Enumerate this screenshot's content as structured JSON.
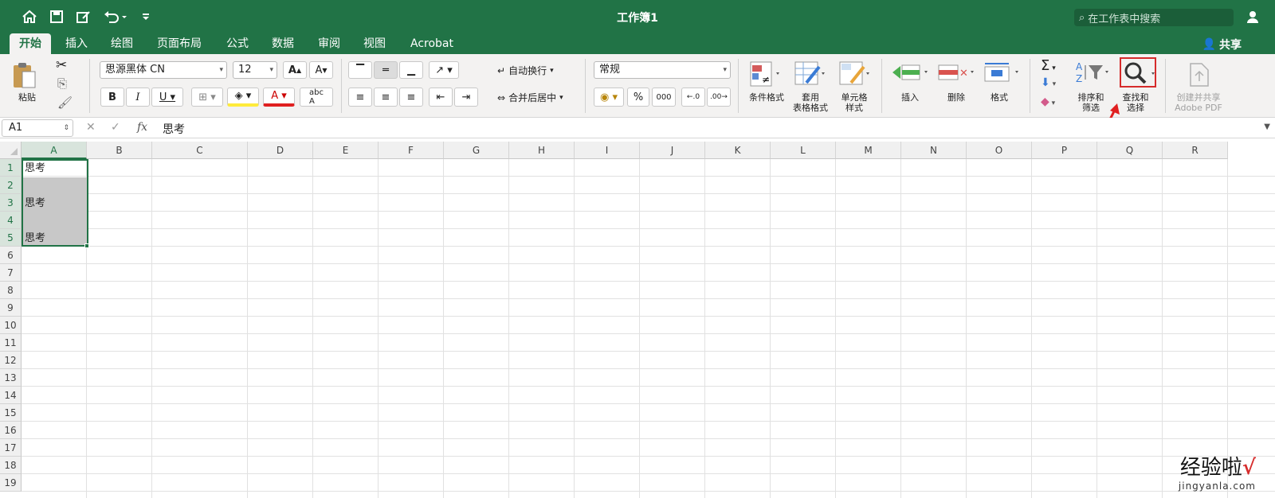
{
  "title_bar": {
    "title": "工作簿1",
    "search_placeholder": "在工作表中搜索"
  },
  "tabs": [
    {
      "label": "开始",
      "active": true
    },
    {
      "label": "插入"
    },
    {
      "label": "绘图"
    },
    {
      "label": "页面布局"
    },
    {
      "label": "公式"
    },
    {
      "label": "数据"
    },
    {
      "label": "审阅"
    },
    {
      "label": "视图"
    },
    {
      "label": "Acrobat"
    }
  ],
  "share_label": "共享",
  "ribbon": {
    "paste_label": "粘贴",
    "font_name": "思源黑体 CN",
    "font_size": "12",
    "wrap_text": "自动换行",
    "merge_center": "合并后居中",
    "number_format": "常规",
    "percent": "%",
    "comma": "000",
    "conditional_format": "条件格式",
    "format_table_1": "套用",
    "format_table_2": "表格格式",
    "cell_style_1": "单元格",
    "cell_style_2": "样式",
    "insert": "插入",
    "delete": "删除",
    "format": "格式",
    "sort_1": "排序和",
    "sort_2": "筛选",
    "find_1": "查找和",
    "find_2": "选择",
    "pdf_1": "创建并共享",
    "pdf_2": "Adobe PDF"
  },
  "formula_bar": {
    "name_box": "A1",
    "fx": "fx",
    "content": "思考"
  },
  "columns": [
    "A",
    "B",
    "C",
    "D",
    "E",
    "F",
    "G",
    "H",
    "I",
    "J",
    "K",
    "L",
    "M",
    "N",
    "O",
    "P",
    "Q",
    "R"
  ],
  "rows": [
    "1",
    "2",
    "3",
    "4",
    "5",
    "6",
    "7",
    "8",
    "9",
    "10",
    "11",
    "12",
    "13",
    "14",
    "15",
    "16",
    "17",
    "18",
    "19"
  ],
  "cells": {
    "A1": "思考",
    "A3": "思考",
    "A5": "思考"
  },
  "watermark": {
    "main": "经验啦",
    "check": "√",
    "sub": "jingyanla.com"
  },
  "colors": {
    "brand": "#217346",
    "selected_fill": "#c8c8c8",
    "highlight": "#d62b2b"
  }
}
